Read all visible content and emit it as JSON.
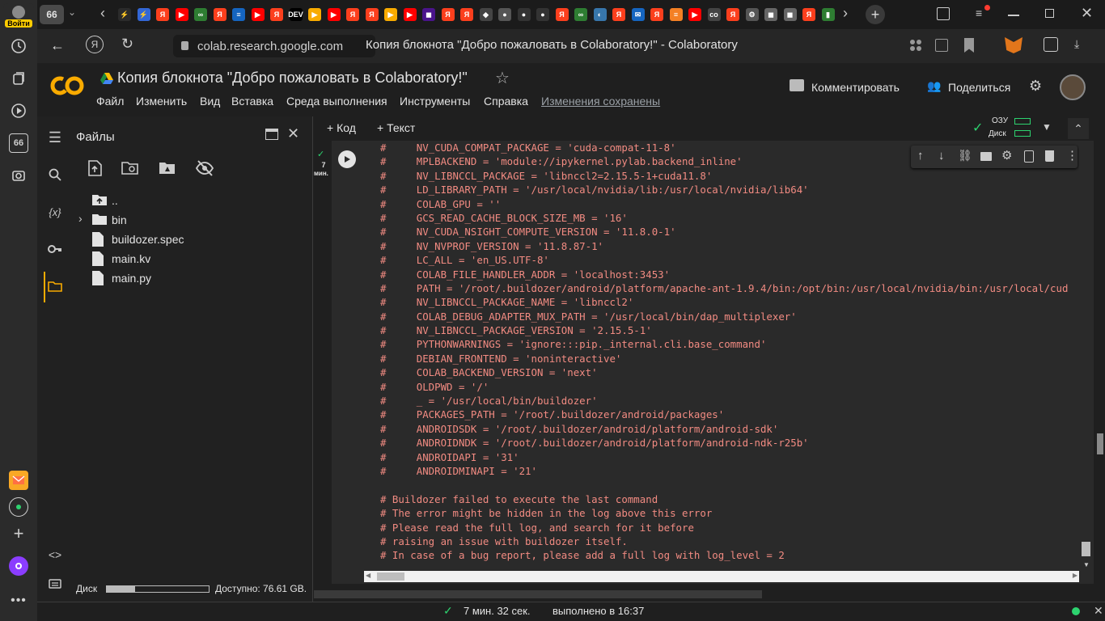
{
  "browser": {
    "login_label": "Войти",
    "tab_count": "66",
    "tab_count_side": "66",
    "url": "colab.research.google.com",
    "page_title": "Копия блокнота \"Добро пожаловать в Colaboratory!\" - Colaboratory",
    "tab_favicons": [
      {
        "name": "tab-icon-1",
        "text": "⚡",
        "color": "#2b2b2b"
      },
      {
        "name": "tab-icon-2",
        "text": "⚡",
        "color": "#3367d6"
      },
      {
        "name": "tab-icon-3",
        "text": "Я",
        "color": "#fc3f1d"
      },
      {
        "name": "tab-icon-4",
        "text": "▶",
        "color": "#ff0000"
      },
      {
        "name": "tab-icon-5",
        "text": "∞",
        "color": "#2e7d32"
      },
      {
        "name": "tab-icon-6",
        "text": "Я",
        "color": "#fc3f1d"
      },
      {
        "name": "tab-icon-7",
        "text": "≡",
        "color": "#1565c0"
      },
      {
        "name": "tab-icon-8",
        "text": "▶",
        "color": "#ff0000"
      },
      {
        "name": "tab-icon-9",
        "text": "Я",
        "color": "#fc3f1d"
      },
      {
        "name": "tab-icon-10",
        "text": "DEV",
        "color": "#000000"
      },
      {
        "name": "tab-icon-11",
        "text": "▶",
        "color": "#f9ab00"
      },
      {
        "name": "tab-icon-12",
        "text": "▶",
        "color": "#ff0000"
      },
      {
        "name": "tab-icon-13",
        "text": "Я",
        "color": "#fc3f1d"
      },
      {
        "name": "tab-icon-14",
        "text": "Я",
        "color": "#fc3f1d"
      },
      {
        "name": "tab-icon-15",
        "text": "▶",
        "color": "#f9ab00"
      },
      {
        "name": "tab-icon-16",
        "text": "▶",
        "color": "#ff0000"
      },
      {
        "name": "tab-icon-17",
        "text": "◼",
        "color": "#4a148c"
      },
      {
        "name": "tab-icon-18",
        "text": "Я",
        "color": "#fc3f1d"
      },
      {
        "name": "tab-icon-19",
        "text": "Я",
        "color": "#fc3f1d"
      },
      {
        "name": "tab-icon-20",
        "text": "◆",
        "color": "#444444"
      },
      {
        "name": "tab-icon-21",
        "text": "●",
        "color": "#555555"
      },
      {
        "name": "tab-icon-22",
        "text": "●",
        "color": "#333333"
      },
      {
        "name": "tab-icon-23",
        "text": "●",
        "color": "#333333"
      },
      {
        "name": "tab-icon-24",
        "text": "Я",
        "color": "#fc3f1d"
      },
      {
        "name": "tab-icon-25",
        "text": "∞",
        "color": "#2e7d32"
      },
      {
        "name": "tab-icon-26",
        "text": "◐",
        "color": "#3776ab"
      },
      {
        "name": "tab-icon-27",
        "text": "Я",
        "color": "#fc3f1d"
      },
      {
        "name": "tab-icon-28",
        "text": "✉",
        "color": "#1565c0"
      },
      {
        "name": "tab-icon-29",
        "text": "Я",
        "color": "#fc3f1d"
      },
      {
        "name": "tab-icon-30",
        "text": "≡",
        "color": "#f48024"
      },
      {
        "name": "tab-icon-31",
        "text": "▶",
        "color": "#ff0000"
      },
      {
        "name": "tab-icon-32",
        "text": "co",
        "color": "#444444"
      },
      {
        "name": "tab-icon-33",
        "text": "Я",
        "color": "#fc3f1d"
      },
      {
        "name": "tab-icon-34",
        "text": "⚙",
        "color": "#555555"
      },
      {
        "name": "tab-icon-35",
        "text": "◼",
        "color": "#666666"
      },
      {
        "name": "tab-icon-36",
        "text": "◼",
        "color": "#666666"
      },
      {
        "name": "tab-icon-37",
        "text": "Я",
        "color": "#fc3f1d"
      },
      {
        "name": "tab-icon-38",
        "text": "▮",
        "color": "#2e7d32"
      }
    ]
  },
  "colab": {
    "notebook_title": "Копия блокнота \"Добро пожаловать в Colaboratory!\"",
    "menu": [
      "Файл",
      "Изменить",
      "Вид",
      "Вставка",
      "Среда выполнения",
      "Инструменты",
      "Справка"
    ],
    "save_status": "Изменения сохранены",
    "comment_label": "Комментировать",
    "share_label": "Поделиться",
    "add_code_label": "+ Код",
    "add_text_label": "+ Текст",
    "ram_label": "ОЗУ",
    "disk_label": "Диск",
    "accent_color": "#f9ab00"
  },
  "files": {
    "panel_title": "Файлы",
    "items": [
      {
        "label": "..",
        "type": "parent"
      },
      {
        "label": "bin",
        "type": "folder"
      },
      {
        "label": "buildozer.spec",
        "type": "file"
      },
      {
        "label": "main.kv",
        "type": "file"
      },
      {
        "label": "main.py",
        "type": "file"
      }
    ],
    "disk_label": "Диск",
    "disk_available": "Доступно: 76.61 GB.",
    "disk_used_fraction": 0.28
  },
  "cell": {
    "exec_count": "7",
    "exec_unit": "мин.",
    "output_lines": [
      "#     NV_CUDA_COMPAT_PACKAGE = 'cuda-compat-11-8'",
      "#     MPLBACKEND = 'module://ipykernel.pylab.backend_inline'",
      "#     NV_LIBNCCL_PACKAGE = 'libnccl2=2.15.5-1+cuda11.8'",
      "#     LD_LIBRARY_PATH = '/usr/local/nvidia/lib:/usr/local/nvidia/lib64'",
      "#     COLAB_GPU = ''",
      "#     GCS_READ_CACHE_BLOCK_SIZE_MB = '16'",
      "#     NV_CUDA_NSIGHT_COMPUTE_VERSION = '11.8.0-1'",
      "#     NV_NVPROF_VERSION = '11.8.87-1'",
      "#     LC_ALL = 'en_US.UTF-8'",
      "#     COLAB_FILE_HANDLER_ADDR = 'localhost:3453'",
      "#     PATH = '/root/.buildozer/android/platform/apache-ant-1.9.4/bin:/opt/bin:/usr/local/nvidia/bin:/usr/local/cud",
      "#     NV_LIBNCCL_PACKAGE_NAME = 'libnccl2'",
      "#     COLAB_DEBUG_ADAPTER_MUX_PATH = '/usr/local/bin/dap_multiplexer'",
      "#     NV_LIBNCCL_PACKAGE_VERSION = '2.15.5-1'",
      "#     PYTHONWARNINGS = 'ignore:::pip._internal.cli.base_command'",
      "#     DEBIAN_FRONTEND = 'noninteractive'",
      "#     COLAB_BACKEND_VERSION = 'next'",
      "#     OLDPWD = '/'",
      "#     _ = '/usr/local/bin/buildozer'",
      "#     PACKAGES_PATH = '/root/.buildozer/android/packages'",
      "#     ANDROIDSDK = '/root/.buildozer/android/platform/android-sdk'",
      "#     ANDROIDNDK = '/root/.buildozer/android/platform/android-ndk-r25b'",
      "#     ANDROIDAPI = '31'",
      "#     ANDROIDMINAPI = '21'",
      "",
      "# Buildozer failed to execute the last command",
      "# The error might be hidden in the log above this error",
      "# Please read the full log, and search for it before",
      "# raising an issue with buildozer itself.",
      "# In case of a bug report, please add a full log with log_level = 2"
    ]
  },
  "status": {
    "duration": "7 мин. 32 сек.",
    "completed": "выполнено в 16:37"
  }
}
